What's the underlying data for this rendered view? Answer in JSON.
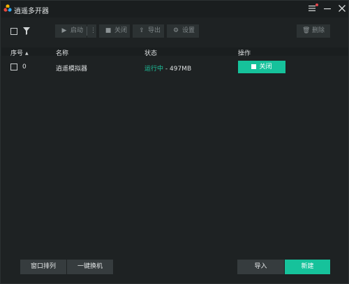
{
  "titlebar": {
    "title": "逍遥多开器",
    "icons": [
      "app-logo",
      "menu-icon",
      "minimize-icon",
      "close-icon"
    ]
  },
  "toolbar": {
    "start_label": "启动",
    "more_label": "⋮",
    "stop_label": "关闭",
    "export_label": "导出",
    "settings_label": "设置",
    "delete_label": "删除"
  },
  "table": {
    "headers": {
      "seq": "序号",
      "name": "名称",
      "status": "状态",
      "action": "操作"
    },
    "rows": [
      {
        "seq": "0",
        "name": "逍遥模拟器",
        "status": "运行中",
        "status_sep": " - ",
        "memory": "497MB",
        "action_label": "关闭"
      }
    ]
  },
  "footer": {
    "arrange_label": "窗口排列",
    "switch_label": "一键换机",
    "import_label": "导入",
    "new_label": "新建"
  },
  "colors": {
    "accent": "#16c29b",
    "running": "#1cc8a0",
    "background": "#1e2223",
    "notification_dot": "#e5484d"
  }
}
